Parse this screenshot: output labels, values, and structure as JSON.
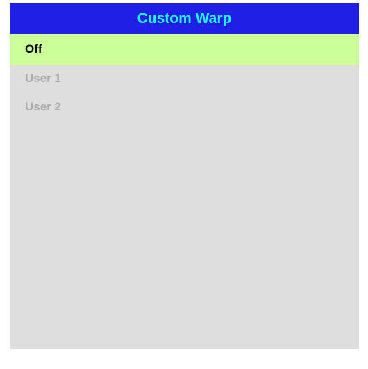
{
  "menu": {
    "title": "Custom Warp",
    "items": [
      {
        "label": "Off",
        "selected": true
      },
      {
        "label": "User 1",
        "selected": false
      },
      {
        "label": "User 2",
        "selected": false
      }
    ]
  },
  "colors": {
    "header_background": "#1f1fe6",
    "header_text": "#1ff6ff",
    "panel_background": "#dedede",
    "selected_background": "#ccff99",
    "selected_text": "#000000",
    "inactive_text": "#ababab"
  }
}
